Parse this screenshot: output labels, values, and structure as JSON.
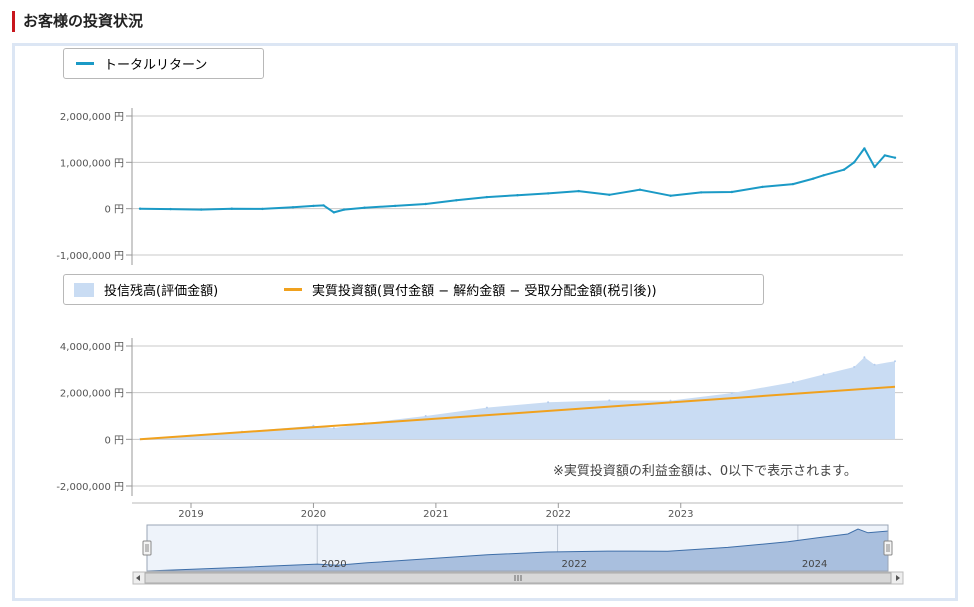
{
  "header": {
    "title": "お客様の投資状況"
  },
  "legend_top": {
    "items": [
      {
        "label": "トータルリターン",
        "color": "#1b9ac6"
      }
    ]
  },
  "legend_bottom": {
    "items": [
      {
        "label": "投信残高(評価金額)",
        "color": "#c9dcf3"
      },
      {
        "label": "実質投資額(買付金額 − 解約金額 − 受取分配金額(税引後))",
        "color": "#f0a11e"
      }
    ]
  },
  "note": "※実質投資額の利益金額は、0以下で表示されます。",
  "colors": {
    "return_line": "#1b9ac6",
    "balance_area": "#c9dcf3",
    "invested_line": "#f0a11e",
    "navigator_area": "#a9bfde",
    "header_accent": "#c8161d"
  },
  "chart_data": [
    {
      "type": "line",
      "ylim": [
        -1000000,
        2000000
      ],
      "yticks": [
        "2,000,000 円",
        "1,000,000 円",
        "0 円",
        "-1,000,000 円"
      ],
      "ytick_values": [
        2000000,
        1000000,
        0,
        -1000000
      ],
      "x_start": "2018-08",
      "x_end": "2024-10",
      "series": [
        {
          "name": "トータルリターン",
          "x": [
            "2018-08",
            "2018-11",
            "2019-02",
            "2019-05",
            "2019-08",
            "2019-11",
            "2020-01",
            "2020-02",
            "2020-03",
            "2020-04",
            "2020-06",
            "2020-09",
            "2020-12",
            "2021-03",
            "2021-06",
            "2021-09",
            "2021-12",
            "2022-03",
            "2022-06",
            "2022-09",
            "2022-12",
            "2023-03",
            "2023-06",
            "2023-09",
            "2023-12",
            "2024-02",
            "2024-03",
            "2024-05",
            "2024-06",
            "2024-07",
            "2024-08",
            "2024-09",
            "2024-10"
          ],
          "values": [
            0,
            -10000,
            -20000,
            0,
            -5000,
            30000,
            60000,
            70000,
            -80000,
            -20000,
            20000,
            60000,
            100000,
            180000,
            250000,
            290000,
            330000,
            380000,
            300000,
            410000,
            280000,
            350000,
            360000,
            470000,
            530000,
            650000,
            720000,
            840000,
            1000000,
            1300000,
            900000,
            1150000,
            1100000
          ]
        }
      ]
    },
    {
      "type": "area",
      "ylim": [
        -2000000,
        4000000
      ],
      "yticks": [
        "4,000,000 円",
        "2,000,000 円",
        "0 円",
        "-2,000,000 円"
      ],
      "ytick_values": [
        4000000,
        2000000,
        0,
        -2000000
      ],
      "x_start": "2018-08",
      "x_end": "2024-10",
      "xticks": [
        "2019",
        "2020",
        "2021",
        "2022",
        "2023"
      ],
      "xtick_dates": [
        "2019-01",
        "2020-01",
        "2021-01",
        "2022-01",
        "2023-01"
      ],
      "series": [
        {
          "name": "投信残高(評価金額)",
          "x": [
            "2018-08",
            "2019-01",
            "2019-06",
            "2020-01",
            "2020-03",
            "2020-06",
            "2020-12",
            "2021-06",
            "2021-12",
            "2022-06",
            "2022-12",
            "2023-06",
            "2023-12",
            "2024-03",
            "2024-06",
            "2024-07",
            "2024-08",
            "2024-10"
          ],
          "values": [
            0,
            150000,
            330000,
            580000,
            480000,
            690000,
            1000000,
            1360000,
            1590000,
            1670000,
            1660000,
            1980000,
            2450000,
            2780000,
            3100000,
            3520000,
            3200000,
            3350000
          ]
        },
        {
          "name": "実質投資額(買付金額 − 解約金額 − 受取分配金額(税引後))",
          "x": [
            "2018-08",
            "2024-10"
          ],
          "values": [
            0,
            2250000
          ]
        }
      ]
    },
    {
      "type": "area",
      "role": "navigator",
      "x_start": "2018-08",
      "x_end": "2024-10",
      "xticks": [
        "2020",
        "2022",
        "2024"
      ],
      "xtick_dates": [
        "2020-01",
        "2022-01",
        "2024-01"
      ],
      "series": [
        {
          "x": [
            "2018-08",
            "2019-06",
            "2020-01",
            "2020-03",
            "2020-06",
            "2021-06",
            "2021-12",
            "2022-06",
            "2022-12",
            "2023-06",
            "2023-12",
            "2024-03",
            "2024-06",
            "2024-07",
            "2024-08",
            "2024-10"
          ],
          "values": [
            0,
            330000,
            580000,
            480000,
            690000,
            1360000,
            1590000,
            1670000,
            1660000,
            1980000,
            2450000,
            2780000,
            3100000,
            3520000,
            3200000,
            3350000
          ]
        }
      ]
    }
  ]
}
